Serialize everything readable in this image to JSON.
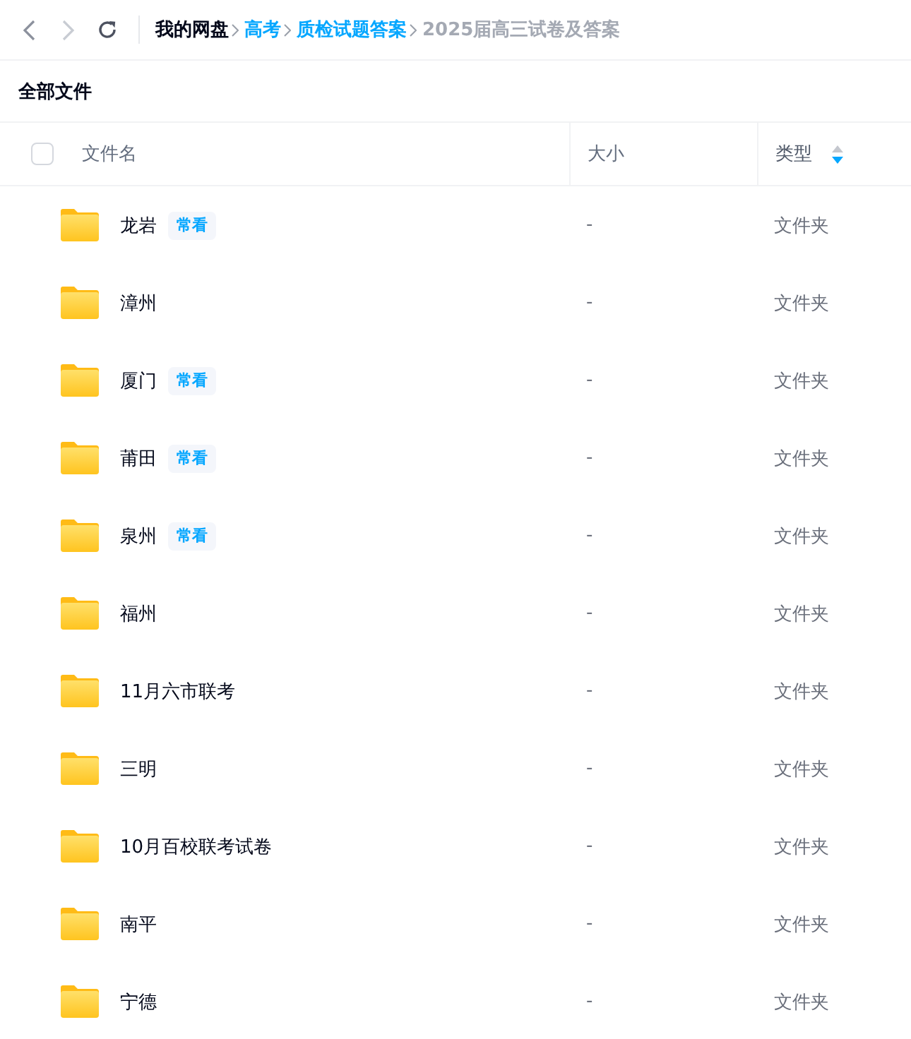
{
  "nav": [
    {
      "kind": "back",
      "disabled": false
    },
    {
      "kind": "forward",
      "disabled": true
    },
    {
      "kind": "refresh",
      "disabled": false
    }
  ],
  "breadcrumb": [
    {
      "label": "我的网盘",
      "kind": "root"
    },
    {
      "label": "高考",
      "kind": "link"
    },
    {
      "label": "质检试题答案",
      "kind": "link"
    },
    {
      "label": "2025届高三试卷及答案",
      "kind": "current"
    }
  ],
  "section_title": "全部文件",
  "table": {
    "select_all": {
      "checked": false
    },
    "columns": [
      {
        "label": "文件名",
        "sorted": false
      },
      {
        "label": "大小",
        "sorted": false
      },
      {
        "label": "类型",
        "sorted": true,
        "descending": true
      }
    ],
    "rows": [
      {
        "name": "龙岩",
        "tag": "常看",
        "size": "-",
        "type": "文件夹"
      },
      {
        "name": "漳州",
        "size": "-",
        "type": "文件夹"
      },
      {
        "name": "厦门",
        "tag": "常看",
        "size": "-",
        "type": "文件夹"
      },
      {
        "name": "莆田",
        "tag": "常看",
        "size": "-",
        "type": "文件夹"
      },
      {
        "name": "泉州",
        "tag": "常看",
        "size": "-",
        "type": "文件夹"
      },
      {
        "name": "福州",
        "size": "-",
        "type": "文件夹"
      },
      {
        "name": "11月六市联考",
        "size": "-",
        "type": "文件夹"
      },
      {
        "name": "三明",
        "size": "-",
        "type": "文件夹"
      },
      {
        "name": "10月百校联考试卷",
        "size": "-",
        "type": "文件夹"
      },
      {
        "name": "南平",
        "size": "-",
        "type": "文件夹"
      },
      {
        "name": "宁德",
        "size": "-",
        "type": "文件夹"
      }
    ]
  }
}
